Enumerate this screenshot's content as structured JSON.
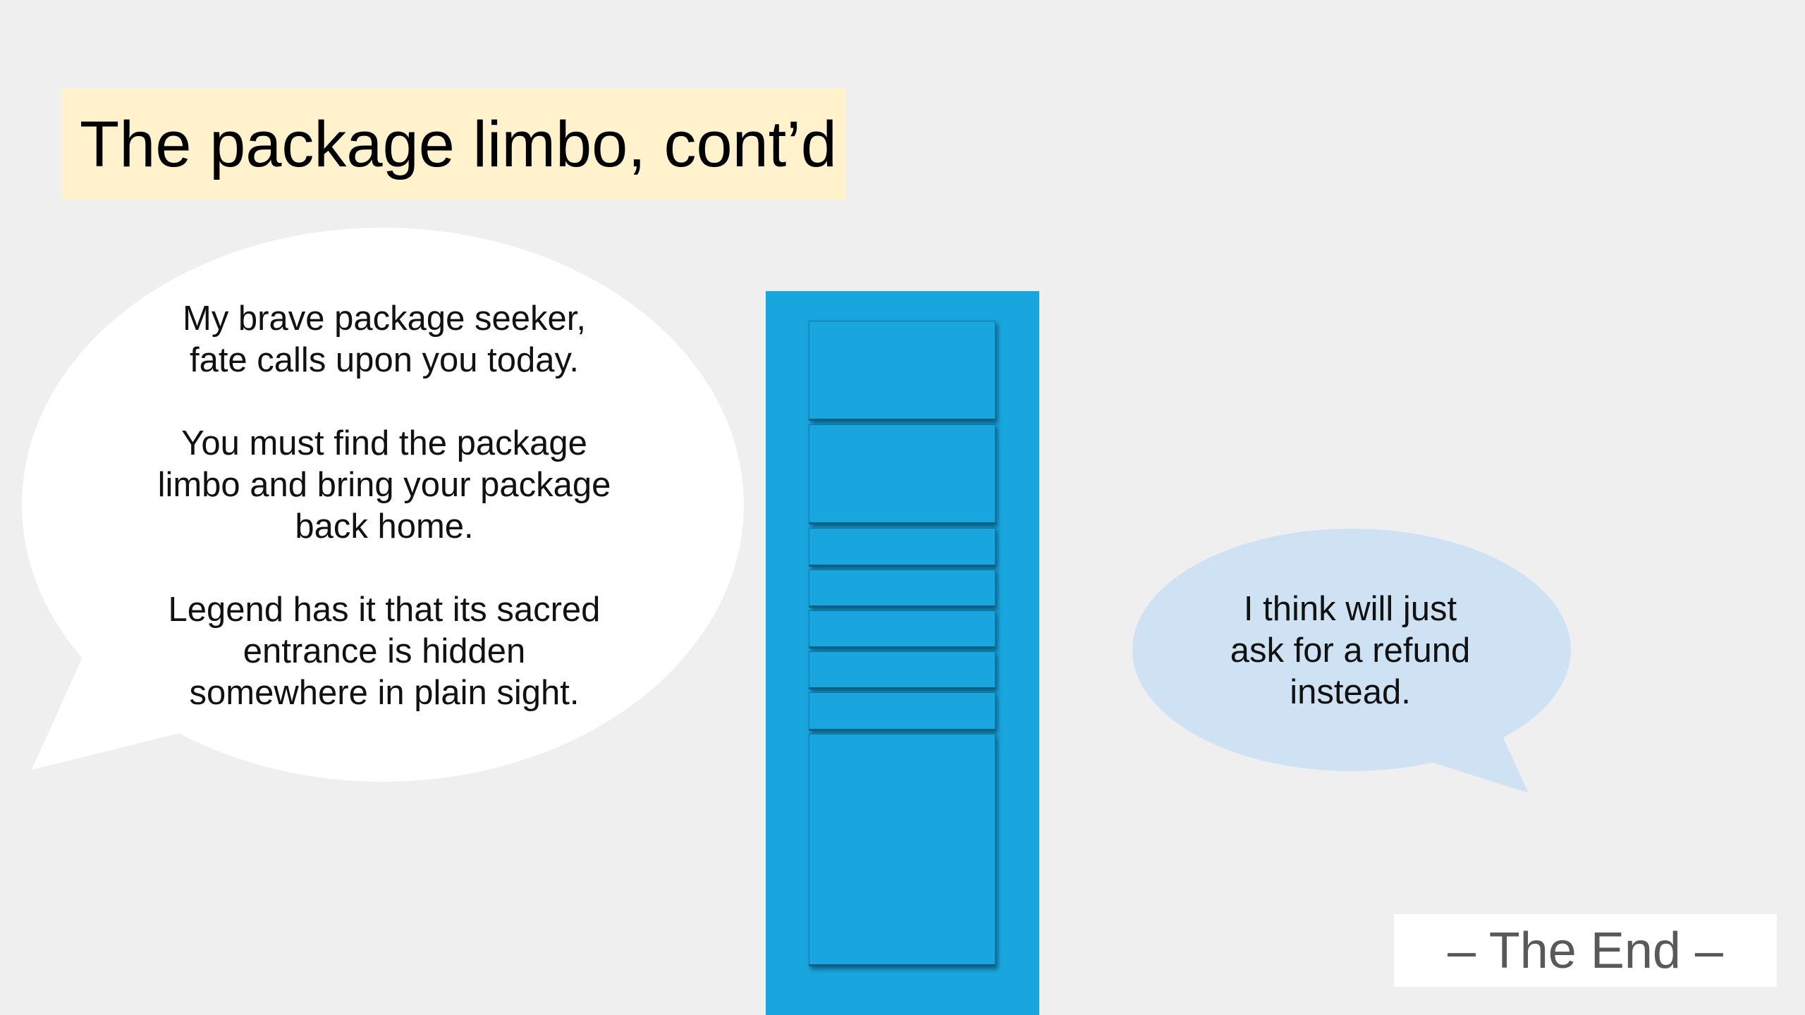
{
  "slide": {
    "title": "The package limbo, cont’d",
    "left_bubble": {
      "paragraph_1": [
        "My brave package seeker,",
        "fate calls upon you today."
      ],
      "paragraph_2": [
        "You must find the package",
        "limbo and bring your package",
        "back home."
      ],
      "paragraph_3": [
        "Legend has it that its sacred",
        "entrance is hidden",
        "somewhere in plain sight."
      ]
    },
    "right_bubble": {
      "lines": [
        "I think will just",
        "ask for a refund",
        "instead."
      ]
    },
    "end_label": "– The End –"
  },
  "colors": {
    "background": "#efefef",
    "title_fill": "#fff2cc",
    "left_bubble_fill": "#ffffff",
    "right_bubble_fill": "#cfe2f3",
    "cabinet_fill": "#19a6de",
    "end_text": "#595959"
  },
  "icons": {
    "cabinet": "filing-cabinet-icon"
  }
}
